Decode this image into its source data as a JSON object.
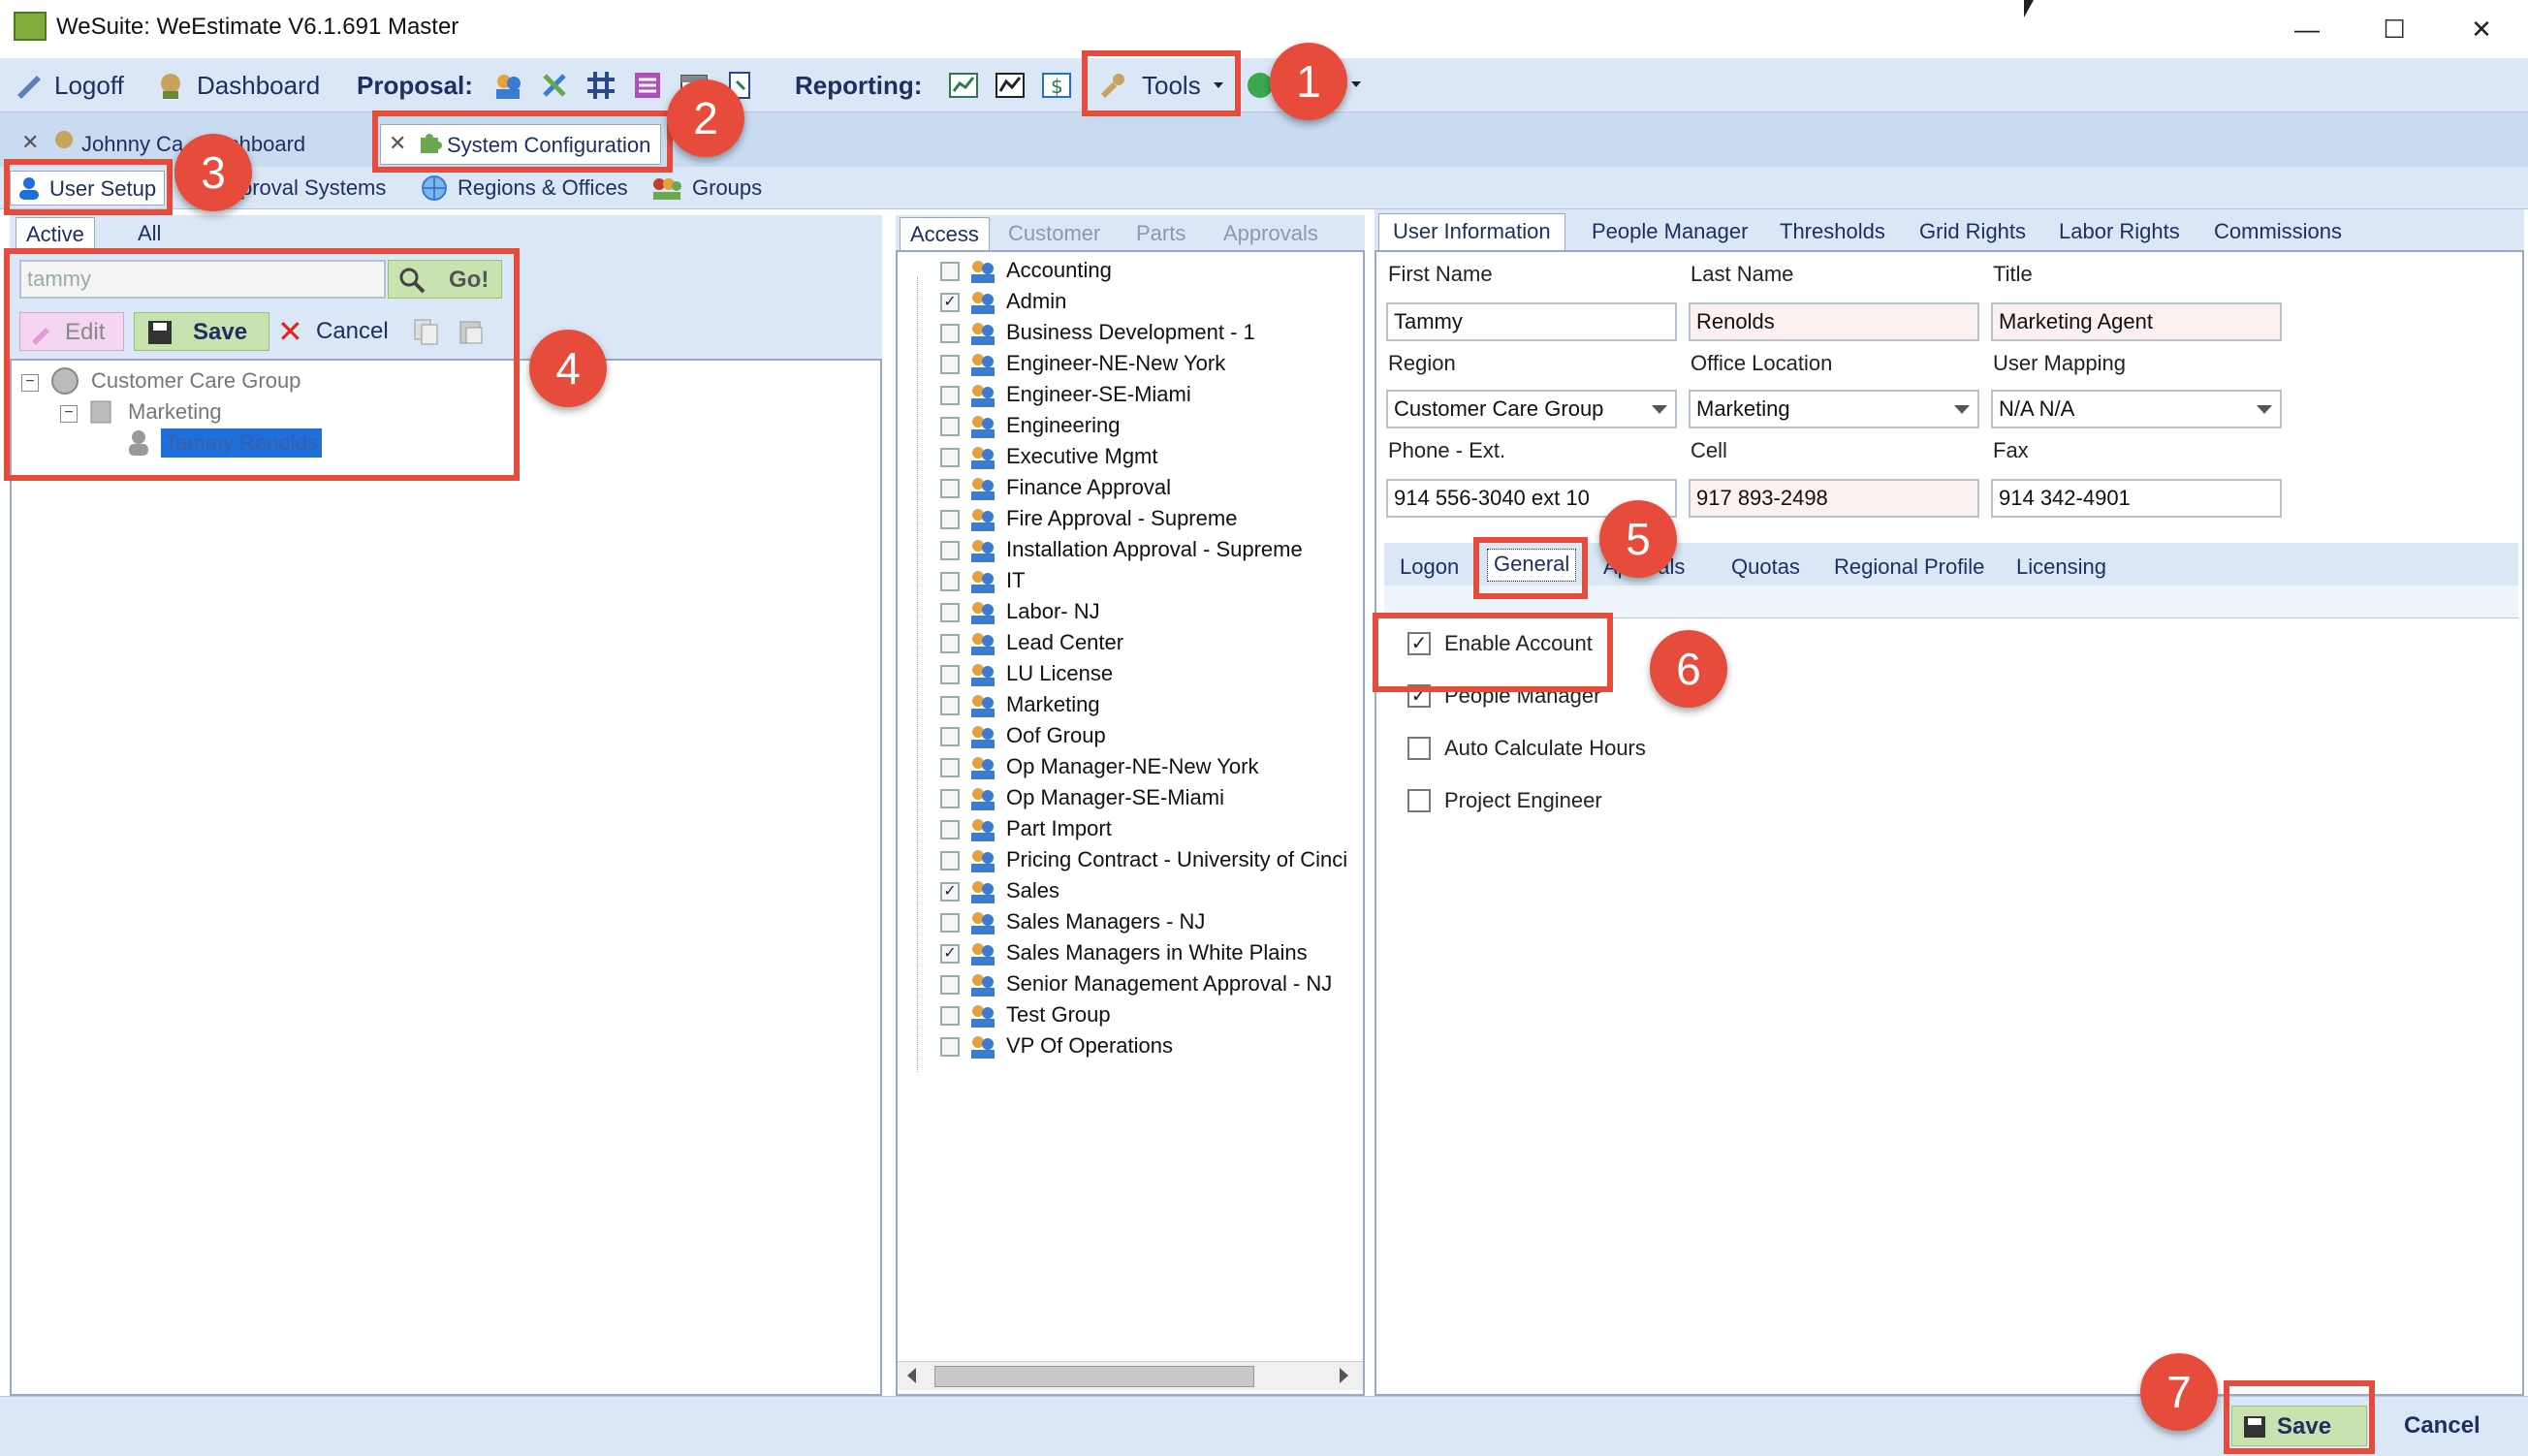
{
  "window": {
    "title": "WeSuite: WeEstimate V6.1.691 Master",
    "minimize": "—",
    "maximize": "☐",
    "close": "✕"
  },
  "toolbar": {
    "logoff": "Logoff",
    "dashboard": "Dashboard",
    "proposal": "Proposal:",
    "reporting": "Reporting:",
    "tools": "Tools"
  },
  "tabs": {
    "dashboard_tab": "Johnny Ca...Dashboard",
    "sysconfig_tab": "System Configuration"
  },
  "subnav": {
    "user_setup": "User Setup",
    "approval_systems": "proval Systems",
    "regions": "Regions & Offices",
    "groups": "Groups"
  },
  "left": {
    "tab_active": "Active",
    "tab_all": "All",
    "search_value": "tammy",
    "go": "Go!",
    "edit": "Edit",
    "save": "Save",
    "cancel": "Cancel",
    "tree": {
      "group": "Customer Care Group",
      "dept": "Marketing",
      "user": "Tammy Renolds"
    }
  },
  "middle": {
    "tabs": [
      "Access",
      "Customer",
      "Parts",
      "Approvals"
    ],
    "groups": [
      {
        "label": "Accounting",
        "checked": false
      },
      {
        "label": "Admin",
        "checked": true
      },
      {
        "label": "Business Development - 1",
        "checked": false
      },
      {
        "label": "Engineer-NE-New York",
        "checked": false
      },
      {
        "label": "Engineer-SE-Miami",
        "checked": false
      },
      {
        "label": "Engineering",
        "checked": false
      },
      {
        "label": "Executive Mgmt",
        "checked": false
      },
      {
        "label": "Finance Approval",
        "checked": false
      },
      {
        "label": "Fire Approval - Supreme",
        "checked": false
      },
      {
        "label": "Installation Approval - Supreme",
        "checked": false
      },
      {
        "label": "IT",
        "checked": false
      },
      {
        "label": "Labor- NJ",
        "checked": false
      },
      {
        "label": "Lead Center",
        "checked": false
      },
      {
        "label": "LU License",
        "checked": false
      },
      {
        "label": "Marketing",
        "checked": false
      },
      {
        "label": "Oof Group",
        "checked": false
      },
      {
        "label": "Op Manager-NE-New York",
        "checked": false
      },
      {
        "label": "Op Manager-SE-Miami",
        "checked": false
      },
      {
        "label": "Part Import",
        "checked": false
      },
      {
        "label": "Pricing Contract - University of Cinci",
        "checked": false
      },
      {
        "label": "Sales",
        "checked": true
      },
      {
        "label": "Sales Managers - NJ",
        "checked": false
      },
      {
        "label": "Sales Managers in White Plains",
        "checked": true
      },
      {
        "label": "Senior Management Approval - NJ",
        "checked": false
      },
      {
        "label": "Test Group",
        "checked": false
      },
      {
        "label": "VP Of Operations",
        "checked": false
      }
    ]
  },
  "right": {
    "tabs": [
      "User Information",
      "People Manager",
      "Thresholds",
      "Grid Rights",
      "Labor Rights",
      "Commissions"
    ],
    "labels": {
      "first_name": "First Name",
      "last_name": "Last Name",
      "title": "Title",
      "region": "Region",
      "office_location": "Office Location",
      "user_mapping": "User Mapping",
      "phone": "Phone - Ext.",
      "cell": "Cell",
      "fax": "Fax"
    },
    "values": {
      "first_name": "Tammy",
      "last_name": "Renolds",
      "title": "Marketing Agent",
      "region": "Customer Care Group",
      "office_location": "Marketing",
      "user_mapping": "N/A N/A",
      "phone": "914 556-3040 ext 10",
      "cell": "917 893-2498",
      "fax": "914 342-4901"
    },
    "subtabs": {
      "logon": "Logon",
      "general": "General",
      "approvals": "Ap...vals",
      "quotas": "Quotas",
      "regional_profile": "Regional Profile",
      "licensing": "Licensing"
    },
    "options": [
      {
        "label": "Enable Account",
        "checked": true
      },
      {
        "label": "People Manager",
        "checked": true
      },
      {
        "label": "Auto Calculate Hours",
        "checked": false
      },
      {
        "label": "Project Engineer",
        "checked": false
      }
    ],
    "save": "Save",
    "cancel": "Cancel"
  },
  "steps": [
    "1",
    "2",
    "3",
    "4",
    "5",
    "6",
    "7"
  ],
  "colors": {
    "accent_red": "#e64b3c",
    "toolbar_bg": "#dbe7f6",
    "selection": "#1e6fd9"
  }
}
